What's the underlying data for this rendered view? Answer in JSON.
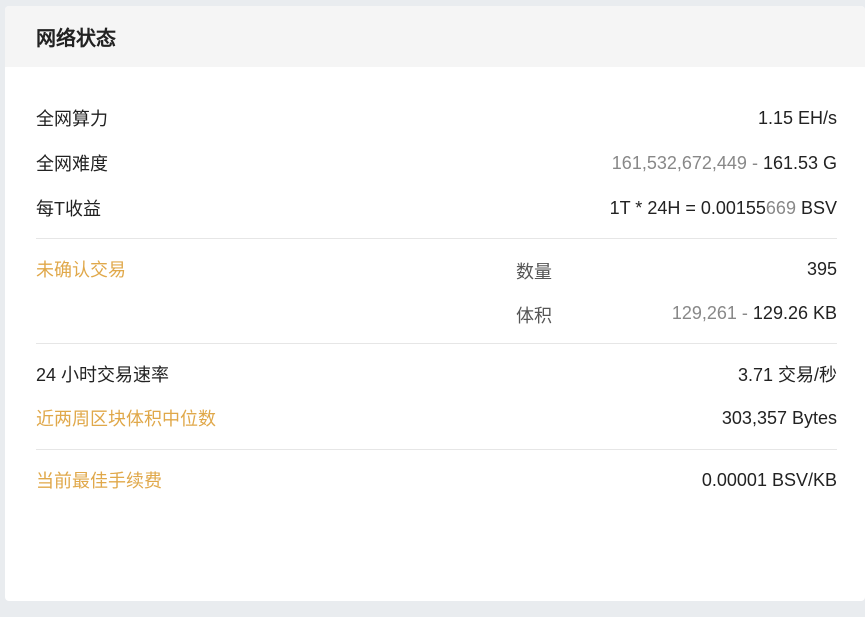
{
  "header": {
    "title": "网络状态"
  },
  "network": {
    "hashrate_label": "全网算力",
    "hashrate_value": "1.15 EH/s",
    "difficulty_label": "全网难度",
    "difficulty_raw": "161,532,672,449",
    "difficulty_sep": " - ",
    "difficulty_short": "161.53 G",
    "earnings_label": "每T收益",
    "earnings_prefix": "1T * 24H = 0.00155",
    "earnings_tail": "669",
    "earnings_unit": " BSV"
  },
  "unconfirmed": {
    "label": "未确认交易",
    "count_label": "数量",
    "count_value": "395",
    "size_label": "体积",
    "size_raw": "129,261",
    "size_sep": " - ",
    "size_short": "129.26 KB"
  },
  "rates": {
    "tx_rate_label": "24 小时交易速率",
    "tx_rate_value": "3.71 交易/秒",
    "median_block_label": "近两周区块体积中位数",
    "median_block_value": "303,357 Bytes"
  },
  "fee": {
    "label": "当前最佳手续费",
    "value": "0.00001 BSV/KB"
  },
  "colors": {
    "accent_gold": "#e0a84a",
    "header_bg": "#f5f5f5",
    "page_bg": "#e9ecef"
  }
}
